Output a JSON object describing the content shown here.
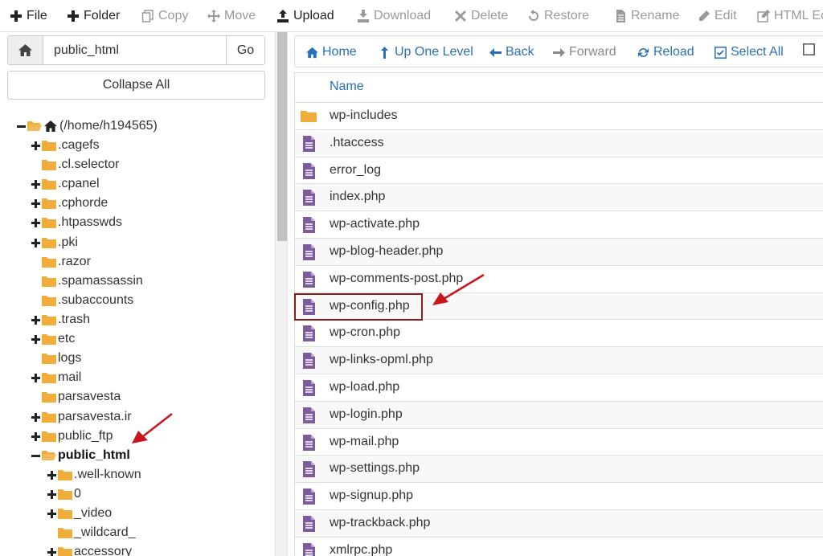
{
  "toolbar": {
    "file": "File",
    "folder": "Folder",
    "copy": "Copy",
    "move": "Move",
    "upload": "Upload",
    "download": "Download",
    "delete": "Delete",
    "restore": "Restore",
    "rename": "Rename",
    "edit": "Edit",
    "html_editor": "HTML Ec"
  },
  "left": {
    "path_value": "public_html",
    "go_label": "Go",
    "collapse_label": "Collapse All",
    "tree": [
      {
        "label": "(/home/h194565)",
        "toggle": "minus",
        "icon": "home-open"
      },
      {
        "label": ".cagefs",
        "toggle": "plus"
      },
      {
        "label": ".cl.selector",
        "toggle": ""
      },
      {
        "label": ".cpanel",
        "toggle": "plus"
      },
      {
        "label": ".cphorde",
        "toggle": "plus"
      },
      {
        "label": ".htpasswds",
        "toggle": "plus"
      },
      {
        "label": ".pki",
        "toggle": "plus"
      },
      {
        "label": ".razor",
        "toggle": ""
      },
      {
        "label": ".spamassassin",
        "toggle": ""
      },
      {
        "label": ".subaccounts",
        "toggle": ""
      },
      {
        "label": ".trash",
        "toggle": "plus"
      },
      {
        "label": "etc",
        "toggle": "plus"
      },
      {
        "label": "logs",
        "toggle": ""
      },
      {
        "label": "mail",
        "toggle": "plus"
      },
      {
        "label": "parsavesta",
        "toggle": ""
      },
      {
        "label": "parsavesta.ir",
        "toggle": "plus"
      },
      {
        "label": "public_ftp",
        "toggle": "plus"
      },
      {
        "label": "public_html",
        "toggle": "minus",
        "bold": true
      },
      {
        "label": ".well-known",
        "toggle": "plus"
      },
      {
        "label": "0",
        "toggle": "plus"
      },
      {
        "label": "_video",
        "toggle": "plus"
      },
      {
        "label": "_wildcard_",
        "toggle": ""
      },
      {
        "label": "accessory",
        "toggle": "plus"
      }
    ]
  },
  "nav": {
    "home": "Home",
    "up": "Up One Level",
    "back": "Back",
    "forward": "Forward",
    "reload": "Reload",
    "select_all": "Select All"
  },
  "files": {
    "header": "Name",
    "rows": [
      {
        "name": "wp-includes",
        "type": "folder"
      },
      {
        "name": ".htaccess",
        "type": "file"
      },
      {
        "name": "error_log",
        "type": "file"
      },
      {
        "name": "index.php",
        "type": "file"
      },
      {
        "name": "wp-activate.php",
        "type": "file"
      },
      {
        "name": "wp-blog-header.php",
        "type": "file"
      },
      {
        "name": "wp-comments-post.php",
        "type": "file"
      },
      {
        "name": "wp-config.php",
        "type": "file"
      },
      {
        "name": "wp-cron.php",
        "type": "file"
      },
      {
        "name": "wp-links-opml.php",
        "type": "file"
      },
      {
        "name": "wp-load.php",
        "type": "file"
      },
      {
        "name": "wp-login.php",
        "type": "file"
      },
      {
        "name": "wp-mail.php",
        "type": "file"
      },
      {
        "name": "wp-settings.php",
        "type": "file"
      },
      {
        "name": "wp-signup.php",
        "type": "file"
      },
      {
        "name": "wp-trackback.php",
        "type": "file"
      },
      {
        "name": "xmlrpc.php",
        "type": "file"
      }
    ]
  },
  "colors": {
    "folder": "#f0ad3c",
    "file": "#7d5c9e",
    "link": "#2a70b8",
    "annotation": "#c8161d"
  }
}
